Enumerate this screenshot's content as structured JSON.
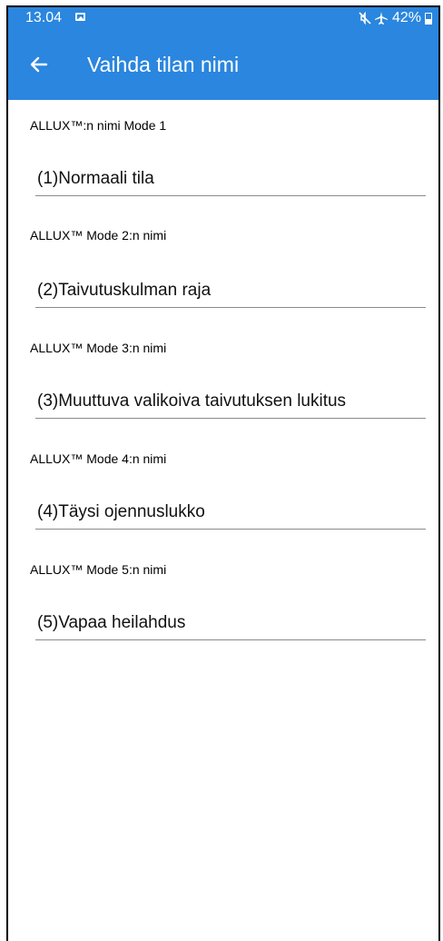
{
  "status_bar": {
    "time": "13.04",
    "icons": [
      "gallery-icon",
      "mute-icon",
      "airplane-icon",
      "battery-icon"
    ],
    "battery_percent": "42%",
    "battery_level_fraction": 0.42
  },
  "app_bar": {
    "back_icon": "arrow-left-icon",
    "title": "Vaihda tilan nimi",
    "background_color": "#2a86de"
  },
  "modes": [
    {
      "label": "ALLUX™:n nimi Mode 1",
      "value": "(1)Normaali tila"
    },
    {
      "label": "ALLUX™ Mode 2:n nimi",
      "value": "(2)Taivutuskulman raja"
    },
    {
      "label": "ALLUX™ Mode 3:n nimi",
      "value": "(3)Muuttuva valikoiva taivutuksen lukitus"
    },
    {
      "label": "ALLUX™ Mode 4:n nimi",
      "value": "(4)Täysi ojennuslukko"
    },
    {
      "label": "ALLUX™ Mode 5:n nimi",
      "value": "(5)Vapaa heilahdus"
    }
  ]
}
